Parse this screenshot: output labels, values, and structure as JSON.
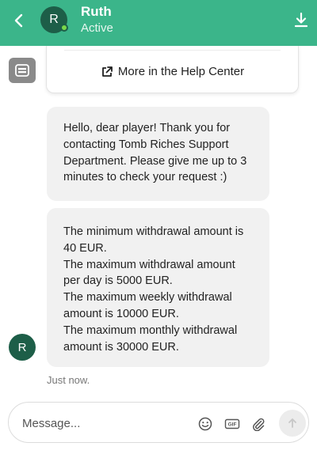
{
  "header": {
    "agent_name": "Ruth",
    "agent_status": "Active",
    "avatar_initial": "R",
    "background_color": "#3bb58a",
    "icons": {
      "back": "chevron-left-icon",
      "download": "download-icon"
    }
  },
  "help_card": {
    "link_label": "More in the Help Center",
    "icon": "external-link-icon"
  },
  "messages": [
    {
      "lines": [
        "Hello, dear player! Thank you for",
        "contacting Tomb Riches Support",
        "Department. Please give me up to 3",
        "minutes to check your request :)"
      ]
    },
    {
      "lines": [
        "The minimum withdrawal amount is",
        "40 EUR.",
        "The maximum withdrawal amount",
        "per day is 5000 EUR.",
        "The maximum weekly withdrawal",
        "amount is 10000 EUR.",
        "The maximum monthly withdrawal",
        "amount is 30000 EUR."
      ]
    }
  ],
  "agent_avatar_initial": "R",
  "timestamp": "Just now.",
  "composer": {
    "placeholder": "Message...",
    "icons": [
      "smiley-icon",
      "gif-icon",
      "paperclip-icon",
      "send-arrow-icon"
    ],
    "gif_label": "GIF"
  }
}
